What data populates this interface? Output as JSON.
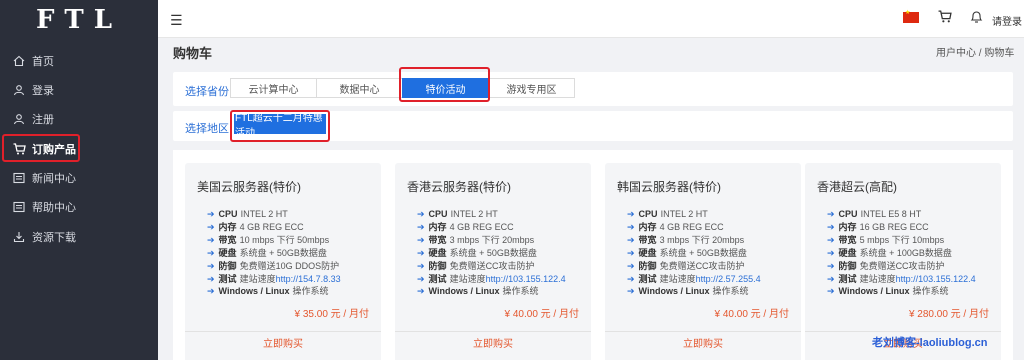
{
  "sidebar": {
    "logo": "FTL",
    "items": [
      {
        "label": "首页",
        "icon": "home-icon"
      },
      {
        "label": "登录",
        "icon": "user-icon"
      },
      {
        "label": "注册",
        "icon": "user-add-icon"
      },
      {
        "label": "订购产品",
        "icon": "cart-icon"
      },
      {
        "label": "新闻中心",
        "icon": "news-icon"
      },
      {
        "label": "帮助中心",
        "icon": "help-icon"
      },
      {
        "label": "资源下载",
        "icon": "download-icon"
      }
    ]
  },
  "topbar": {
    "menu_icon": "hamburger-icon",
    "login_label": "请登录"
  },
  "page": {
    "title": "购物车",
    "breadcrumb": "用户中心 / 购物车"
  },
  "filters": {
    "category_label": "选择省份",
    "category_tabs": [
      "云计算中心",
      "数据中心",
      "特价活动",
      "游戏专用区"
    ],
    "region_label": "选择地区",
    "region_tabs": [
      "FTL超云十二月特惠活动"
    ]
  },
  "products": [
    {
      "title": "美国云服务器(特价)",
      "specs": [
        {
          "key": "CPU",
          "val": "INTEL 2 HT"
        },
        {
          "key": "内存",
          "val": "4 GB REG ECC"
        },
        {
          "key": "带宽",
          "val": "10 mbps 下行 50mbps"
        },
        {
          "key": "硬盘",
          "val": "系统盘 + 50GB数据盘"
        },
        {
          "key": "防御",
          "val": "免费赠送10G DDOS防护"
        },
        {
          "key": "测试",
          "val": "建站速度",
          "link": "http://154.7.8.33"
        },
        {
          "key": "Windows / Linux",
          "val": "操作系统"
        }
      ],
      "price": "¥ 35.00 元 / 月付",
      "buy": "立即购买"
    },
    {
      "title": "香港云服务器(特价)",
      "specs": [
        {
          "key": "CPU",
          "val": "INTEL 2 HT"
        },
        {
          "key": "内存",
          "val": "4 GB REG ECC"
        },
        {
          "key": "带宽",
          "val": "3 mbps 下行 20mbps"
        },
        {
          "key": "硬盘",
          "val": "系统盘 + 50GB数据盘"
        },
        {
          "key": "防御",
          "val": "免费赠送CC攻击防护"
        },
        {
          "key": "测试",
          "val": "建站速度",
          "link": "http://103.155.122.4"
        },
        {
          "key": "Windows / Linux",
          "val": "操作系统"
        }
      ],
      "price": "¥ 40.00 元 / 月付",
      "buy": "立即购买"
    },
    {
      "title": "韩国云服务器(特价)",
      "specs": [
        {
          "key": "CPU",
          "val": "INTEL 2 HT"
        },
        {
          "key": "内存",
          "val": "4 GB REG ECC"
        },
        {
          "key": "带宽",
          "val": "3 mbps 下行 20mbps"
        },
        {
          "key": "硬盘",
          "val": "系统盘 + 50GB数据盘"
        },
        {
          "key": "防御",
          "val": "免费赠送CC攻击防护"
        },
        {
          "key": "测试",
          "val": "建站速度",
          "link": "http://2.57.255.4"
        },
        {
          "key": "Windows / Linux",
          "val": "操作系统"
        }
      ],
      "price": "¥ 40.00 元 / 月付",
      "buy": "立即购买"
    },
    {
      "title": "香港超云(高配)",
      "specs": [
        {
          "key": "CPU",
          "val": "INTEL E5 8 HT"
        },
        {
          "key": "内存",
          "val": "16 GB REG ECC"
        },
        {
          "key": "带宽",
          "val": "5 mbps 下行 10mbps"
        },
        {
          "key": "硬盘",
          "val": "系统盘 + 100GB数据盘"
        },
        {
          "key": "防御",
          "val": "免费赠送CC攻击防护"
        },
        {
          "key": "测试",
          "val": "建站速度",
          "link": "http://103.155.122.4"
        },
        {
          "key": "Windows / Linux",
          "val": "操作系统"
        }
      ],
      "price": "¥ 280.00 元 / 月付",
      "buy": "立即购买"
    }
  ],
  "watermark": "老刘博客-laoliublog.cn",
  "colors": {
    "accent": "#1f6fe0",
    "highlight": "#e0202a",
    "price": "#e4572e",
    "sidebar": "#2b2f3a"
  }
}
